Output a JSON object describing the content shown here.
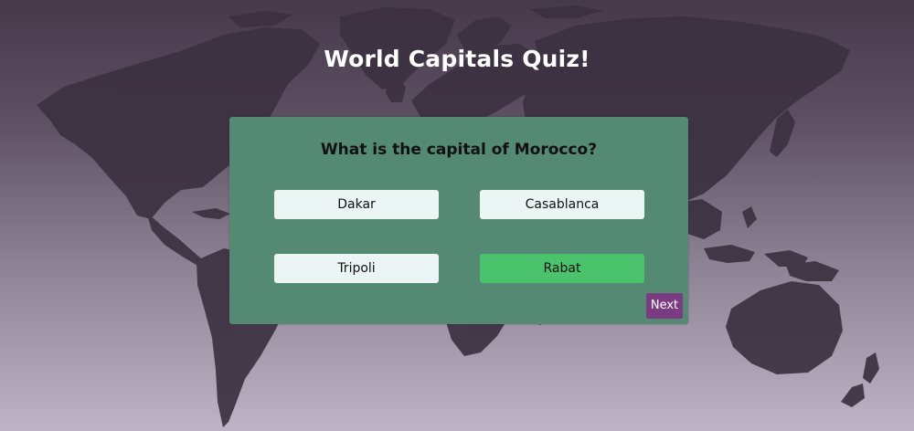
{
  "app": {
    "title": "World Capitals Quiz!"
  },
  "quiz": {
    "question": "What is the capital of Morocco?",
    "answers": [
      {
        "label": "Dakar",
        "state": "default"
      },
      {
        "label": "Casablanca",
        "state": "default"
      },
      {
        "label": "Tripoli",
        "state": "default"
      },
      {
        "label": "Rabat",
        "state": "correct"
      }
    ],
    "next_label": "Next"
  },
  "colors": {
    "card": "#548a73",
    "answer_default": "#ebf5f3",
    "answer_correct": "#4ac36c",
    "next_button": "#7a3b82",
    "map_land": "#3c3140"
  },
  "background": {
    "image": "world-map"
  }
}
